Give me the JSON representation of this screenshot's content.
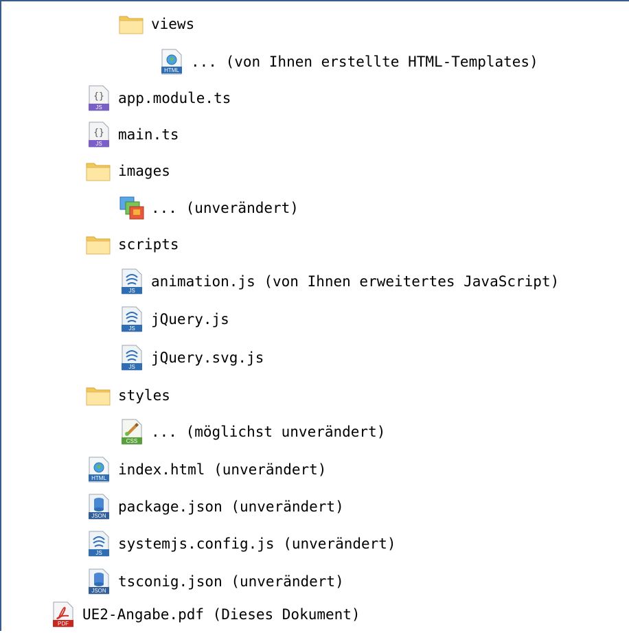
{
  "tree": [
    {
      "label": "views",
      "icon": "folder-icon"
    },
    {
      "label": "... (von Ihnen erstellte HTML-Templates)",
      "icon": "html-file-icon",
      "badge": "HTML"
    },
    {
      "label": "app.module.ts",
      "icon": "ts-file-icon",
      "badge": "JS"
    },
    {
      "label": "main.ts",
      "icon": "ts-file-icon",
      "badge": "JS"
    },
    {
      "label": "images",
      "icon": "folder-icon"
    },
    {
      "label": "... (unverändert)",
      "icon": "image-files-icon"
    },
    {
      "label": "scripts",
      "icon": "folder-icon"
    },
    {
      "label": "animation.js (von Ihnen erweitertes JavaScript)",
      "icon": "js-file-icon",
      "badge": "JS"
    },
    {
      "label": "jQuery.js",
      "icon": "js-file-icon",
      "badge": "JS"
    },
    {
      "label": "jQuery.svg.js",
      "icon": "js-file-icon",
      "badge": "JS"
    },
    {
      "label": "styles",
      "icon": "folder-icon"
    },
    {
      "label": "... (möglichst unverändert)",
      "icon": "css-file-icon",
      "badge": "CSS"
    },
    {
      "label": "index.html (unverändert)",
      "icon": "html-file-icon",
      "badge": "HTML"
    },
    {
      "label": "package.json (unverändert)",
      "icon": "json-file-icon",
      "badge": "JSON"
    },
    {
      "label": "systemjs.config.js (unverändert)",
      "icon": "js-file-icon",
      "badge": "JS"
    },
    {
      "label": "tsconig.json (unverändert)",
      "icon": "json-file-icon",
      "badge": "JSON"
    },
    {
      "label": "UE2-Angabe.pdf (Dieses Dokument)",
      "icon": "pdf-file-icon",
      "badge": "PDF"
    }
  ]
}
